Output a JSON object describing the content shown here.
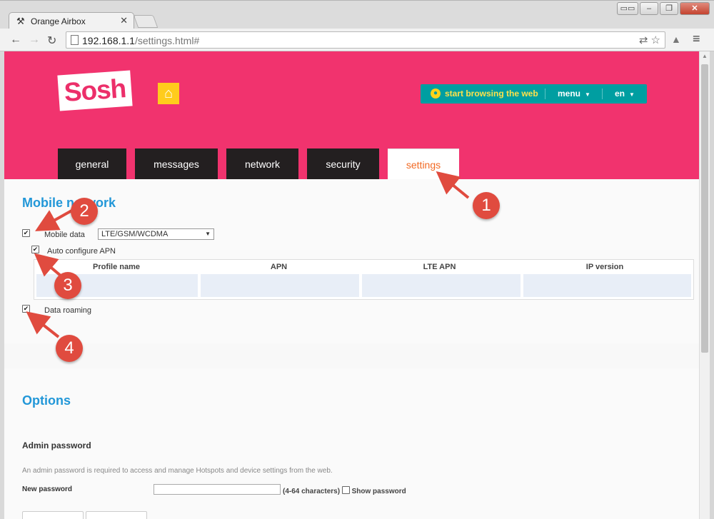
{
  "browser": {
    "tab_title": "Orange Airbox",
    "tab_close": "✕",
    "url_host": "192.168.1.1",
    "url_rest": "/settings.html#"
  },
  "header": {
    "logo": "Sosh",
    "browse_link": "start browsing the web",
    "menu_label": "menu",
    "lang_label": "en"
  },
  "nav_tabs": [
    {
      "label": "general"
    },
    {
      "label": "messages"
    },
    {
      "label": "network"
    },
    {
      "label": "security"
    },
    {
      "label": "settings",
      "active": true
    }
  ],
  "mobile_network": {
    "title": "Mobile network",
    "mobile_data": {
      "label": "Mobile data",
      "checked": true
    },
    "mode_select": {
      "value": "LTE/GSM/WCDMA"
    },
    "auto_apn": {
      "label": "Auto configure APN",
      "checked": true
    },
    "apn_table": {
      "columns": [
        "Profile name",
        "APN",
        "LTE APN",
        "IP version"
      ],
      "rows": [
        [
          "",
          "",
          "",
          ""
        ]
      ]
    },
    "data_roaming": {
      "label": "Data roaming",
      "checked": true
    }
  },
  "options": {
    "title": "Options",
    "admin_title": "Admin password",
    "admin_desc": "An admin password is required to access and manage Hotspots and device settings from the web.",
    "new_password_label": "New password",
    "password_hint": "(4-64 characters)",
    "show_password_label": "Show password"
  },
  "annotations": [
    "1",
    "2",
    "3",
    "4"
  ],
  "colors": {
    "brand_pink": "#f1336e",
    "accent_teal": "#009ea1",
    "title_blue": "#2297d8",
    "active_tab_text": "#f26a24",
    "annotation_red": "#e04b3f"
  },
  "icons": {
    "tab_favicon": "tools-icon",
    "home": "home-icon",
    "globe": "globe-icon"
  }
}
